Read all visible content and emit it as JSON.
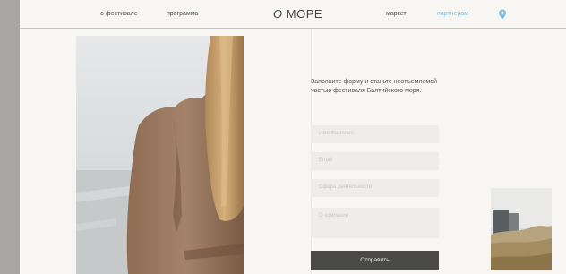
{
  "nav": {
    "festival": "о фестивале",
    "program": "программа",
    "logo_prefix": "О",
    "logo_text": "МОРЕ",
    "market": "маркет",
    "partners": "партнерам"
  },
  "icons": {
    "location": "map-pin-icon"
  },
  "colors": {
    "accent": "#7fc3e4",
    "button": "#4a4a48",
    "page": "#f7f6f3"
  },
  "form": {
    "intro": "Заполните форму и станьте неотъемлемой частью фестиваля Балтийского моря.",
    "name_placeholder": "Имя Фамилия",
    "email_placeholder": "Email",
    "activity_placeholder": "Сфера деятельности",
    "about_placeholder": "О компании",
    "submit_label": "Отправить"
  }
}
